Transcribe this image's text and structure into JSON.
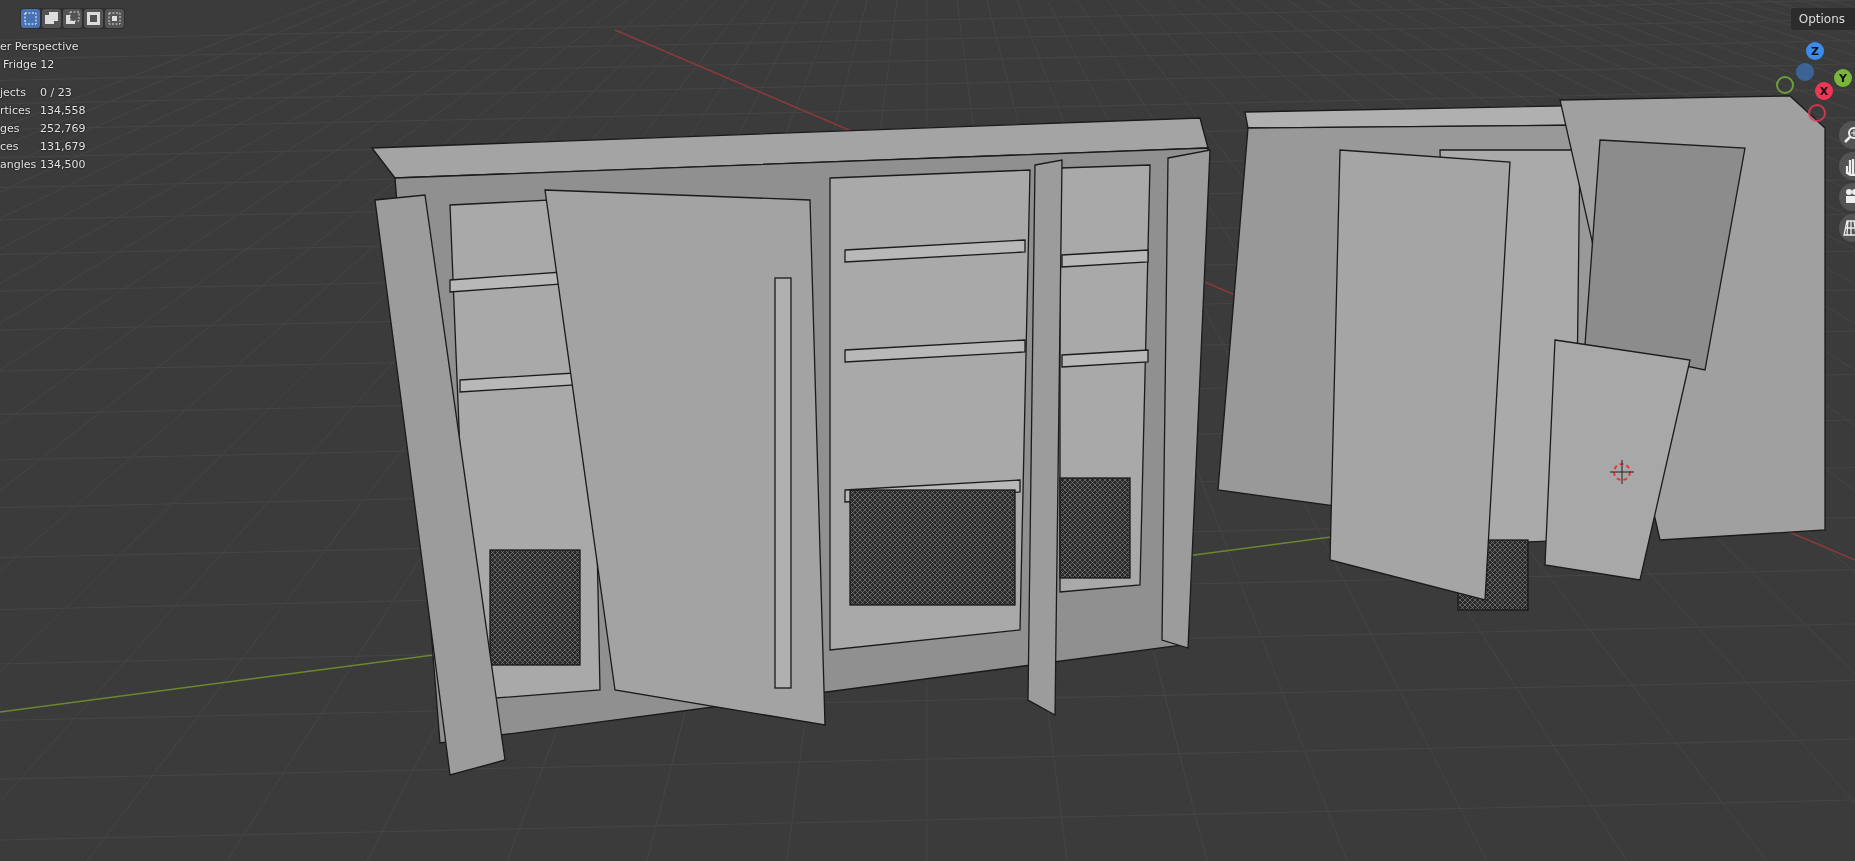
{
  "header": {
    "select_modes": [
      {
        "kind": "new",
        "selected": true
      },
      {
        "kind": "extend",
        "selected": false
      },
      {
        "kind": "subtract",
        "selected": false
      },
      {
        "kind": "difference",
        "selected": false
      },
      {
        "kind": "intersect",
        "selected": false
      }
    ],
    "options": "Options"
  },
  "overlay": {
    "view": "er Perspective",
    "object": "Fridge 12",
    "stats": [
      {
        "label": "jects",
        "value": "0 / 23"
      },
      {
        "label": "rtices",
        "value": "134,558"
      },
      {
        "label": "ges",
        "value": "252,769"
      },
      {
        "label": "ces",
        "value": "131,679"
      },
      {
        "label": "angles",
        "value": "134,500"
      }
    ]
  },
  "gizmo": {
    "axes": [
      {
        "label": "Z",
        "color": "#3d8bec"
      },
      {
        "label": "Y",
        "color": "#78b63a"
      },
      {
        "label": "X",
        "color": "#ef3656"
      }
    ]
  },
  "navigation": [
    {
      "kind": "zoom"
    },
    {
      "kind": "pan"
    },
    {
      "kind": "camera"
    },
    {
      "kind": "ortho"
    }
  ]
}
